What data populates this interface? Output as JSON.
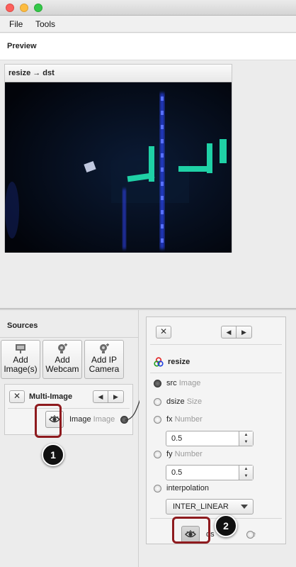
{
  "menu": {
    "file": "File",
    "tools": "Tools"
  },
  "preview": {
    "header": "Preview",
    "card_title": "resize → dst"
  },
  "sources": {
    "title": "Sources",
    "buttons": [
      {
        "line1": "Add",
        "line2": "Image(s)"
      },
      {
        "line1": "Add",
        "line2": "Webcam"
      },
      {
        "line1": "Add IP",
        "line2": "Camera"
      }
    ],
    "multi_image": {
      "close": "✕",
      "title": "Multi-Image",
      "output_name": "Image",
      "output_type": "Image"
    }
  },
  "operation": {
    "close": "✕",
    "name": "resize",
    "inputs": [
      {
        "name": "src",
        "type": "Image"
      },
      {
        "name": "dsize",
        "type": "Size"
      },
      {
        "name": "fx",
        "type": "Number",
        "value": "0.5"
      },
      {
        "name": "fy",
        "type": "Number",
        "value": "0.5"
      },
      {
        "name": "interpolation",
        "type": "",
        "value": "INTER_LINEAR"
      }
    ],
    "output_partial_name": "ds",
    "output_partial_type": "e"
  },
  "callouts": {
    "first": "1",
    "second": "2"
  },
  "colors": {
    "highlight": "#8e1a1e",
    "preview_bg": "#05080f",
    "glow_blue": "#2a48ff",
    "glow_teal": "#1fd1a6"
  },
  "icons": [
    "close-icon",
    "left-arrow-icon",
    "right-arrow-icon",
    "eye-icon",
    "resize-icon",
    "image-icon",
    "webcam-icon",
    "ip-camera-icon"
  ]
}
